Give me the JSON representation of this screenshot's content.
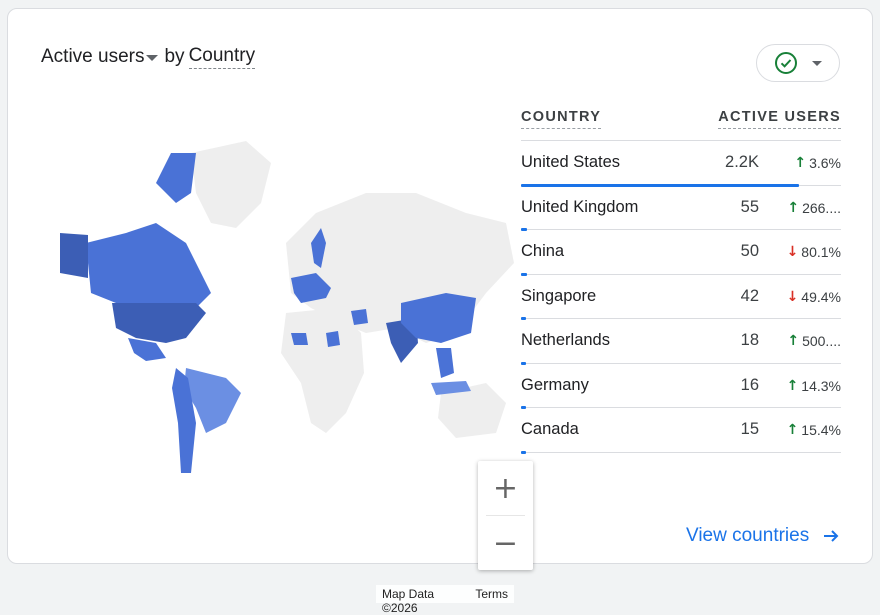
{
  "header": {
    "metric_label": "Active users",
    "by_label": "by",
    "dimension_label": "Country"
  },
  "status_button": {
    "icon": "check-circle-icon",
    "color": "#188038"
  },
  "map": {
    "attribution": "Map Data ©2026",
    "terms": "Terms",
    "zoom_in": "+",
    "zoom_out": "−",
    "colors": {
      "high": "#3c5eb5",
      "mid": "#4a72d6",
      "low": "#6b8fe3",
      "none": "#eeeeee"
    }
  },
  "table": {
    "col_country": "COUNTRY",
    "col_users": "ACTIVE USERS",
    "rows": [
      {
        "country": "United States",
        "users": "2.2K",
        "change": "3.6%",
        "dir": "up",
        "share": 0.87
      },
      {
        "country": "United Kingdom",
        "users": "55",
        "change": "266....",
        "dir": "up",
        "share": 0.02
      },
      {
        "country": "China",
        "users": "50",
        "change": "80.1%",
        "dir": "down",
        "share": 0.02
      },
      {
        "country": "Singapore",
        "users": "42",
        "change": "49.4%",
        "dir": "down",
        "share": 0.015
      },
      {
        "country": "Netherlands",
        "users": "18",
        "change": "500....",
        "dir": "up",
        "share": 0.008
      },
      {
        "country": "Germany",
        "users": "16",
        "change": "14.3%",
        "dir": "up",
        "share": 0.007
      },
      {
        "country": "Canada",
        "users": "15",
        "change": "15.4%",
        "dir": "up",
        "share": 0.006
      }
    ]
  },
  "footer": {
    "link_label": "View countries"
  }
}
